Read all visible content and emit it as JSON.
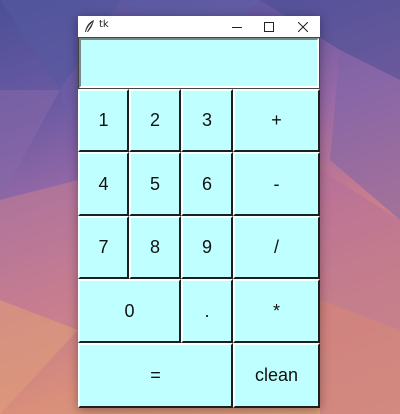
{
  "window": {
    "title": "tk"
  },
  "display": {
    "value": ""
  },
  "keys": {
    "k1": "1",
    "k2": "2",
    "k3": "3",
    "plus": "+",
    "k4": "4",
    "k5": "5",
    "k6": "6",
    "minus": "-",
    "k7": "7",
    "k8": "8",
    "k9": "9",
    "divide": "/",
    "k0": "0",
    "dot": ".",
    "multiply": "*",
    "equals": "=",
    "clean": "clean"
  },
  "colors": {
    "button_bg": "#c0ffff"
  }
}
